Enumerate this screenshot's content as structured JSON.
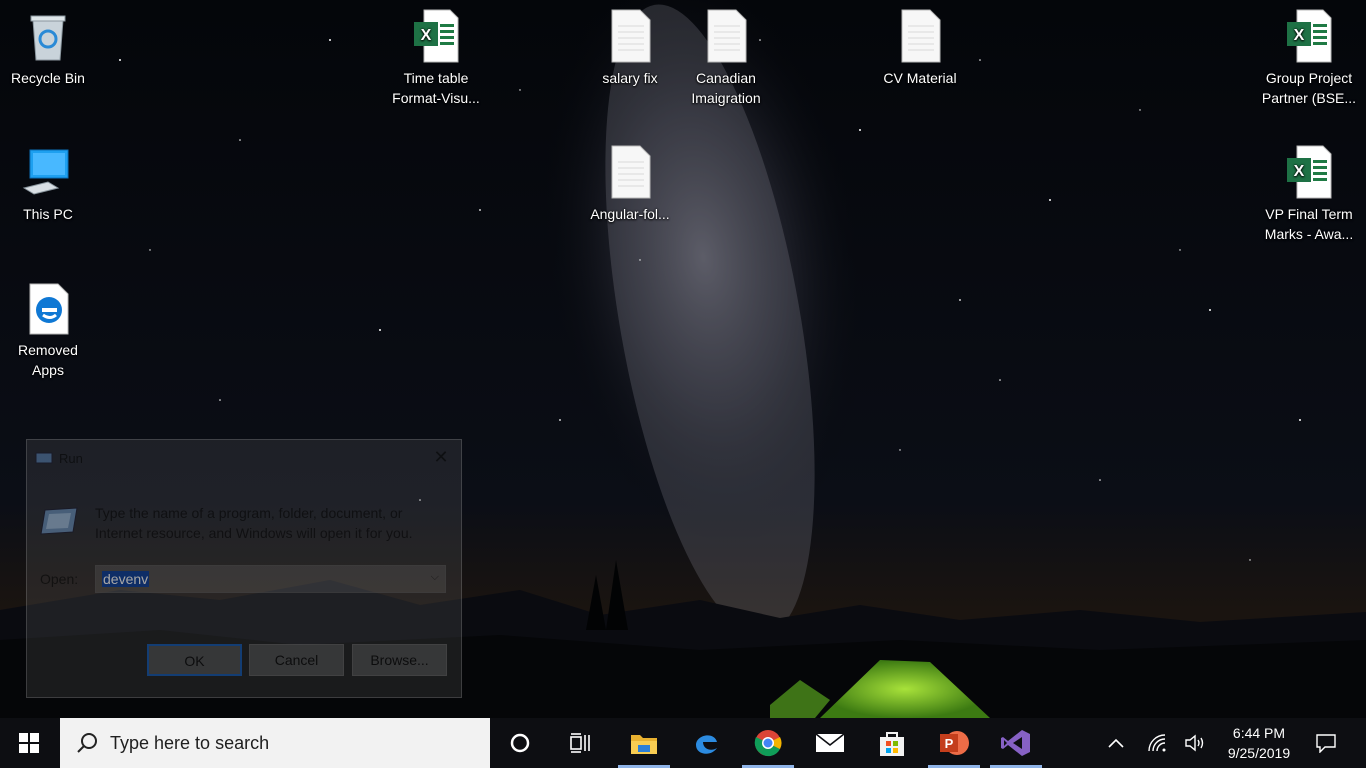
{
  "desktop": {
    "icons": [
      {
        "label": "Recycle Bin",
        "icon": "recycle-bin-icon"
      },
      {
        "label": "This PC",
        "icon": "this-pc-icon"
      },
      {
        "label": "Removed\nApps",
        "icon": "edge-file-icon"
      },
      {
        "label": "Time table\nFormat-Visu...",
        "icon": "excel-file-icon"
      },
      {
        "label": "salary fix",
        "icon": "text-file-icon"
      },
      {
        "label": "Canadian\nImaigration",
        "icon": "text-file-icon"
      },
      {
        "label": "CV Material",
        "icon": "text-file-icon"
      },
      {
        "label": "Group Project\nPartner (BSE...",
        "icon": "excel-file-icon"
      },
      {
        "label": "Angular-fol...",
        "icon": "text-file-icon"
      },
      {
        "label": "VP Final Term\nMarks - Awa...",
        "icon": "excel-file-icon"
      }
    ]
  },
  "run_dialog": {
    "title": "Run",
    "message": "Type the name of a program, folder, document, or Internet resource, and Windows will open it for you.",
    "open_label": "Open:",
    "open_value": "devenv",
    "ok_label": "OK",
    "cancel_label": "Cancel",
    "browse_label": "Browse..."
  },
  "taskbar": {
    "search_placeholder": "Type here to search",
    "pinned": [
      {
        "icon": "cortana-icon",
        "active": false
      },
      {
        "icon": "task-view-icon",
        "active": false
      },
      {
        "icon": "file-explorer-icon",
        "active": true
      },
      {
        "icon": "edge-icon",
        "active": false
      },
      {
        "icon": "chrome-icon",
        "active": true
      },
      {
        "icon": "mail-icon",
        "active": false
      },
      {
        "icon": "store-icon",
        "active": false
      },
      {
        "icon": "powerpoint-icon",
        "active": true
      },
      {
        "icon": "visual-studio-icon",
        "active": true
      }
    ],
    "clock": {
      "time": "6:44 PM",
      "date": "9/25/2019"
    },
    "colors": {
      "accent": "#8fb4e8",
      "taskbar_bg": "#0d0e12",
      "search_bg": "#f2f2f2"
    }
  }
}
